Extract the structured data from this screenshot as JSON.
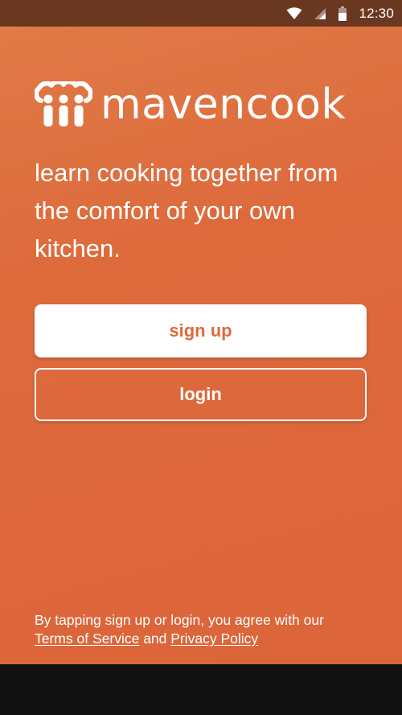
{
  "status_bar": {
    "time": "12:30",
    "icons": [
      "wifi-icon",
      "cell-signal-icon",
      "battery-icon"
    ]
  },
  "app": {
    "brand": "mavencook",
    "tagline": "learn cooking together from the comfort of your own kitchen.",
    "colors": {
      "background": "#dd6a3c",
      "status_bar": "#6a3820",
      "button_text_primary": "#dd6a3c",
      "text": "#ffffff"
    }
  },
  "actions": {
    "signup_label": "sign up",
    "login_label": "login"
  },
  "legal": {
    "prefix": "By tapping sign up or login, you agree with our",
    "terms_label": "Terms of Service",
    "conjunction": "and",
    "privacy_label": "Privacy Policy"
  }
}
